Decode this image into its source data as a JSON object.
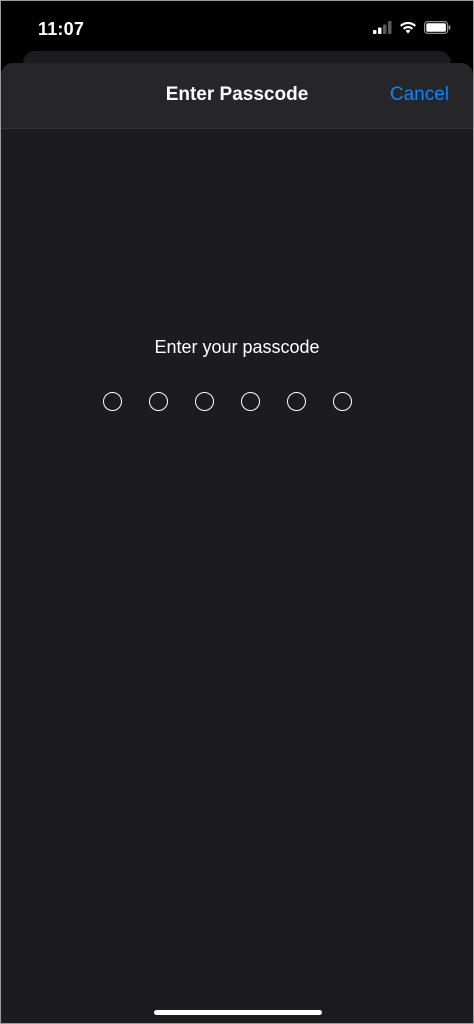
{
  "status_bar": {
    "time": "11:07",
    "icons": [
      "cellular-signal-icon",
      "wifi-icon",
      "battery-icon"
    ]
  },
  "nav": {
    "title": "Enter Passcode",
    "cancel_label": "Cancel"
  },
  "passcode": {
    "prompt": "Enter your passcode",
    "length": 6,
    "entered": 0
  },
  "colors": {
    "background": "#000000",
    "sheet": "#1c1c1e",
    "nav_bar": "#262628",
    "accent": "#0a84ff",
    "text": "#ffffff"
  }
}
